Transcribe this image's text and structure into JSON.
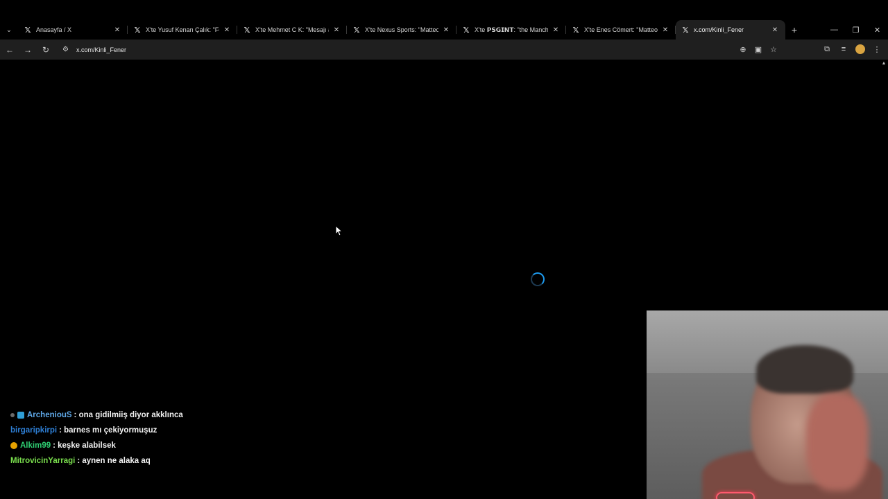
{
  "browser": {
    "tabs": [
      {
        "title": "Anasayfa / X",
        "active": false
      },
      {
        "title": "X'te Yusuf Kenan Çalık: \"Fenerb",
        "active": false
      },
      {
        "title": "X'te Mehmet C K: \"Mesajı alman",
        "active": false
      },
      {
        "title": "X'te Nexus Sports: \"Matteo Gue",
        "active": false
      },
      {
        "title": "X'te 𝗣𝗦𝗚𝗜𝗡𝗧: \"the Manchester",
        "active": false
      },
      {
        "title": "X'te Enes Cömert: \"Matteo Gue",
        "active": false
      },
      {
        "title": "x.com/Kinli_Fener",
        "active": true
      }
    ],
    "url": "x.com/Kinli_Fener"
  },
  "chat": [
    {
      "user": "ArcheniouS",
      "message": ": ona gidilmiiş diyor akklınca",
      "color": "#5fa8e8",
      "badge_color": "#6a6a6a",
      "badge2_color": "#2f9ed6"
    },
    {
      "user": "birgaripkirpi",
      "message": ": barnes mı çekiyormuşuz",
      "color": "#2e7fd6",
      "badge_color": "",
      "badge2_color": ""
    },
    {
      "user": "Alkim99",
      "message": ": keşke alabilsek",
      "color": "#2ecc71",
      "badge_color": "#e5a100",
      "badge2_color": ""
    },
    {
      "user": "MitrovicinYarragi",
      "message": ": aynen ne alaka aq",
      "color": "#7be04e",
      "badge_color": "",
      "badge2_color": ""
    }
  ]
}
